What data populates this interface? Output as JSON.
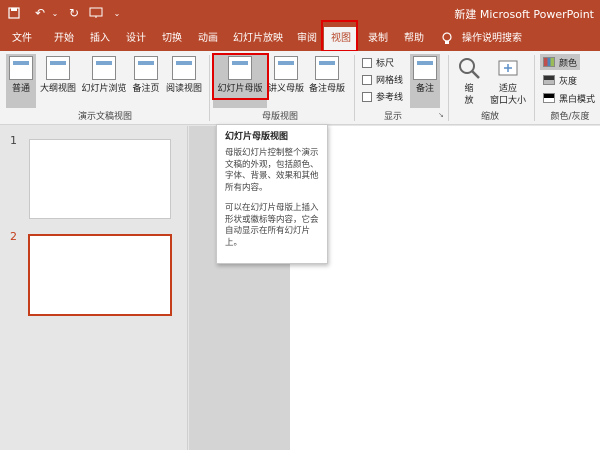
{
  "window": {
    "title": "新建 Microsoft PowerPoint"
  },
  "ribbon_tabs": [
    {
      "label": "文件"
    },
    {
      "label": "开始"
    },
    {
      "label": "插入"
    },
    {
      "label": "设计"
    },
    {
      "label": "切换"
    },
    {
      "label": "动画"
    },
    {
      "label": "幻灯片放映"
    },
    {
      "label": "审阅"
    },
    {
      "label": "视图"
    },
    {
      "label": "录制"
    },
    {
      "label": "帮助"
    },
    {
      "label": "操作说明搜索"
    }
  ],
  "presentation_views": {
    "group_label": "演示文稿视图",
    "buttons": [
      "普通",
      "大纲视图",
      "幻灯片浏览",
      "备注页",
      "阅读视图"
    ]
  },
  "master_views": {
    "group_label": "母版视图",
    "buttons": [
      "幻灯片母版",
      "讲义母版",
      "备注母版"
    ]
  },
  "show": {
    "group_label": "显示",
    "checkboxes": [
      "标尺",
      "网格线",
      "参考线"
    ],
    "notes_button": "备注"
  },
  "zoom": {
    "group_label": "缩放",
    "zoom_button": "缩放",
    "fit_button": "适应\n窗口大小"
  },
  "color_grayscale": {
    "group_label": "颜色/灰度",
    "options": [
      "颜色",
      "灰度",
      "黑白模式"
    ]
  },
  "slides": [
    {
      "number": "1"
    },
    {
      "number": "2"
    }
  ],
  "tooltip": {
    "title": "幻灯片母版视图",
    "paragraph1": "母版幻灯片控制整个演示文稿的外观，包括颜色、字体、背景、效果和其他所有内容。",
    "paragraph2": "可以在幻灯片母版上插入形状或徽标等内容，它会自动显示在所有幻灯片上。"
  },
  "colors": {
    "accent": "#b7472a",
    "highlight": "#e00000",
    "active_slide": "#c43e1c"
  }
}
